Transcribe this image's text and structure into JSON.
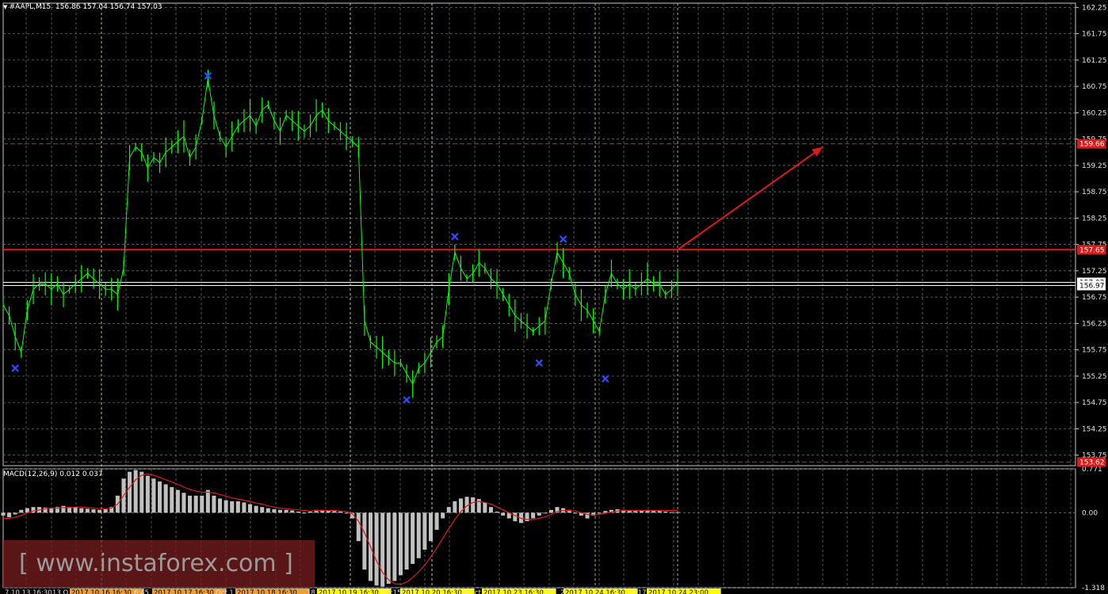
{
  "header": {
    "symbol": "#AAPL,M15",
    "ohlc": "156.86 157.04 156.74 157.03"
  },
  "macd": {
    "label": "MACD(12,26,9) 0.012 0.037",
    "axis_labels": [
      "0.771",
      "0.00",
      "-1.318"
    ]
  },
  "watermark": "[ www.instaforex.com ]",
  "chart_data": {
    "type": "line",
    "title": "",
    "series": [
      {
        "values": [
          156.6,
          156.4,
          156.0,
          155.7,
          156.5,
          156.9,
          157.0,
          157.0,
          156.9,
          157.0,
          156.8,
          156.9,
          157.0,
          157.1,
          157.2,
          157.1,
          157.0,
          156.9,
          156.9,
          156.8,
          157.3,
          159.4,
          159.6,
          159.5,
          159.2,
          159.4,
          159.3,
          159.5,
          159.6,
          159.7,
          159.8,
          159.4,
          159.6,
          160.1,
          160.9,
          160.2,
          159.8,
          159.6,
          159.8,
          160.0,
          160.1,
          160.2,
          160.0,
          160.3,
          160.4,
          160.1,
          159.9,
          160.2,
          160.1,
          160.0,
          159.9,
          160.0,
          160.2,
          160.3,
          160.1,
          160.0,
          159.9,
          159.8,
          159.7,
          159.6,
          156.3,
          155.9,
          155.8,
          155.7,
          155.6,
          155.5,
          155.5,
          155.3,
          155.1,
          155.4,
          155.5,
          155.7,
          155.9,
          156.0,
          156.9,
          157.6,
          157.3,
          157.1,
          157.2,
          157.4,
          157.3,
          157.1,
          157.0,
          156.8,
          156.6,
          156.4,
          156.3,
          156.2,
          156.1,
          156.2,
          156.3,
          157.0,
          157.6,
          157.4,
          157.2,
          156.8,
          156.6,
          156.5,
          156.3,
          156.1,
          156.8,
          157.2,
          157.0,
          156.9,
          157.0,
          156.9,
          157.0,
          157.1,
          157.0,
          157.0,
          156.8,
          156.9,
          157.03
        ]
      }
    ],
    "y_ticks": [
      "162.25",
      "161.75",
      "161.25",
      "160.75",
      "160.25",
      "159.75",
      "159.25",
      "158.75",
      "158.25",
      "157.75",
      "157.25",
      "156.75",
      "156.25",
      "155.75",
      "155.25",
      "154.75",
      "154.25",
      "153.75"
    ],
    "ylim": [
      153.55,
      162.33
    ],
    "x_ticks": [
      "7.10.13 16:30",
      "13 O",
      "2017.10.16 16:30",
      "6:45",
      "2017.10.17 16:30",
      "Oct 1",
      "2017.10.18 16:30",
      "18",
      "2017.10.19 16:30",
      "17:15",
      "2017.10.20 16:30",
      "0 Oct",
      "2017.10.23 16:30",
      "45",
      "2",
      "2017.10.24 16:30",
      "ct 17:",
      "2017.10.24 23:00"
    ],
    "horizontal_levels": [
      {
        "value": 159.66,
        "label": "159.66",
        "color": "#cc1f1f",
        "style": "dashed"
      },
      {
        "value": 157.65,
        "label": "157.65",
        "color": "#e01818",
        "style": "solid"
      },
      {
        "value": 157.03,
        "label": "157.03",
        "color": "#ffffff",
        "style": "solid"
      },
      {
        "value": 156.97,
        "label": "156.97",
        "color": "#ffffff",
        "style": "solid"
      },
      {
        "value": 153.62,
        "label": "153.62",
        "color": "#cc1f1f",
        "style": "dashed"
      }
    ],
    "markers_x_blue": [
      {
        "i": 2,
        "value": 155.4
      },
      {
        "i": 34,
        "value": 160.95
      },
      {
        "i": 67,
        "value": 154.8
      },
      {
        "i": 75,
        "value": 157.9
      },
      {
        "i": 89,
        "value": 155.5
      },
      {
        "i": 93,
        "value": 157.85
      },
      {
        "i": 100,
        "value": 155.2
      }
    ],
    "arrow": {
      "from_value": 157.65,
      "to_value": 159.6,
      "color": "#e01818"
    },
    "macd_histogram": [
      -0.05,
      -0.08,
      -0.03,
      0.05,
      0.08,
      0.1,
      0.1,
      0.09,
      0.08,
      0.1,
      0.12,
      0.1,
      0.1,
      0.08,
      0.07,
      0.06,
      0.05,
      0.06,
      0.1,
      0.3,
      0.6,
      0.72,
      0.75,
      0.72,
      0.65,
      0.6,
      0.55,
      0.5,
      0.45,
      0.4,
      0.35,
      0.3,
      0.3,
      0.3,
      0.4,
      0.3,
      0.25,
      0.22,
      0.2,
      0.2,
      0.18,
      0.15,
      0.12,
      0.1,
      0.08,
      0.06,
      0.05,
      0.05,
      0.04,
      0.02,
      0.0,
      0.02,
      0.05,
      0.05,
      0.04,
      0.03,
      0.02,
      0.0,
      -0.1,
      -0.5,
      -1.0,
      -1.2,
      -1.28,
      -1.3,
      -1.25,
      -1.2,
      -1.1,
      -1.0,
      -0.9,
      -0.8,
      -0.65,
      -0.5,
      -0.3,
      -0.1,
      0.1,
      0.2,
      0.25,
      0.28,
      0.27,
      0.24,
      0.18,
      0.1,
      0.02,
      -0.05,
      -0.1,
      -0.15,
      -0.18,
      -0.15,
      -0.1,
      -0.05,
      0.0,
      0.05,
      0.1,
      0.08,
      0.05,
      0.0,
      -0.05,
      -0.1,
      -0.05,
      0.0,
      0.03,
      0.05,
      0.06,
      0.05,
      0.04,
      0.03,
      0.04,
      0.05,
      0.04,
      0.03,
      0.02,
      0.01,
      0.012
    ],
    "macd_signal": [
      -0.1,
      -0.1,
      -0.08,
      -0.05,
      0.0,
      0.03,
      0.05,
      0.07,
      0.08,
      0.08,
      0.09,
      0.09,
      0.1,
      0.1,
      0.09,
      0.08,
      0.07,
      0.07,
      0.08,
      0.15,
      0.3,
      0.45,
      0.58,
      0.66,
      0.68,
      0.66,
      0.62,
      0.58,
      0.54,
      0.5,
      0.45,
      0.41,
      0.38,
      0.36,
      0.36,
      0.35,
      0.32,
      0.29,
      0.26,
      0.24,
      0.22,
      0.2,
      0.17,
      0.15,
      0.12,
      0.1,
      0.08,
      0.07,
      0.06,
      0.05,
      0.04,
      0.03,
      0.04,
      0.04,
      0.04,
      0.04,
      0.03,
      0.02,
      -0.02,
      -0.15,
      -0.35,
      -0.6,
      -0.85,
      -1.05,
      -1.18,
      -1.25,
      -1.26,
      -1.22,
      -1.14,
      -1.04,
      -0.92,
      -0.78,
      -0.62,
      -0.45,
      -0.28,
      -0.12,
      0.02,
      0.12,
      0.18,
      0.2,
      0.18,
      0.15,
      0.1,
      0.05,
      0.0,
      -0.05,
      -0.1,
      -0.12,
      -0.12,
      -0.1,
      -0.07,
      -0.03,
      0.02,
      0.04,
      0.04,
      0.03,
      0.0,
      -0.03,
      -0.04,
      -0.03,
      -0.01,
      0.01,
      0.03,
      0.04,
      0.04,
      0.04,
      0.04,
      0.04,
      0.04,
      0.04,
      0.04,
      0.04,
      0.037
    ],
    "macd_ylim": [
      -1.318,
      0.771
    ]
  }
}
